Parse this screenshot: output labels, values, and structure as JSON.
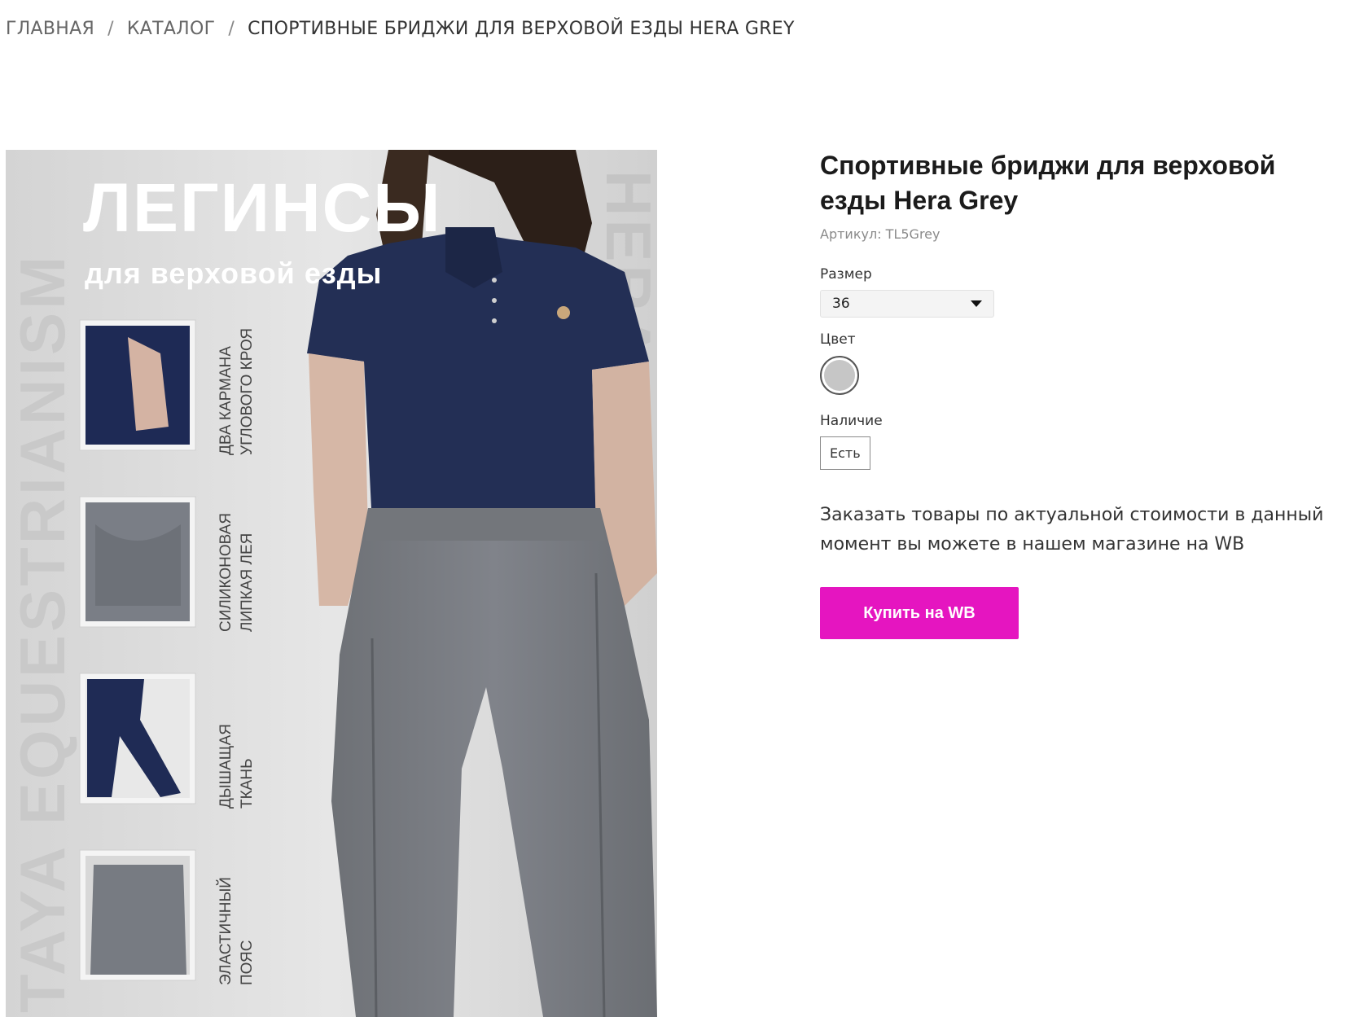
{
  "breadcrumb": {
    "home": "ГЛАВНАЯ",
    "catalog": "КАТАЛОГ",
    "current": "СПОРТИВНЫЕ БРИДЖИ ДЛЯ ВЕРХОВОЙ ЕЗДЫ HERA GREY",
    "separator": "/"
  },
  "product": {
    "title": "Спортивные бриджи для верховой езды Hera Grey",
    "sku_label": "Артикул:",
    "sku_value": "TL5Grey",
    "size_label": "Размер",
    "size_value": "36",
    "color_label": "Цвет",
    "color_swatch": "#c6c6c6",
    "availability_label": "Наличие",
    "availability_value": "Есть",
    "note": "Заказать товары по актуальной стоимости в данный момент вы можете в нашем магазине на WB",
    "buy_label": "Купить на WB",
    "buy_color": "#e515c0"
  },
  "image": {
    "headline": "ЛЕГИНСЫ",
    "subheadline": "для верховой езды",
    "side_text_left": "TAYA EQUESTRIANISM",
    "side_text_right": "HERA",
    "features": [
      {
        "line1": "ДВА КАРМАНА",
        "line2": "УГЛОВОГО КРОЯ"
      },
      {
        "line1": "СИЛИКОНОВАЯ",
        "line2": "ЛИПКАЯ ЛЕЯ"
      },
      {
        "line1": "ДЫШАЩАЯ",
        "line2": "ТКАНЬ"
      },
      {
        "line1": "ЭЛАСТИЧНЫЙ",
        "line2": "ПОЯС"
      }
    ]
  }
}
